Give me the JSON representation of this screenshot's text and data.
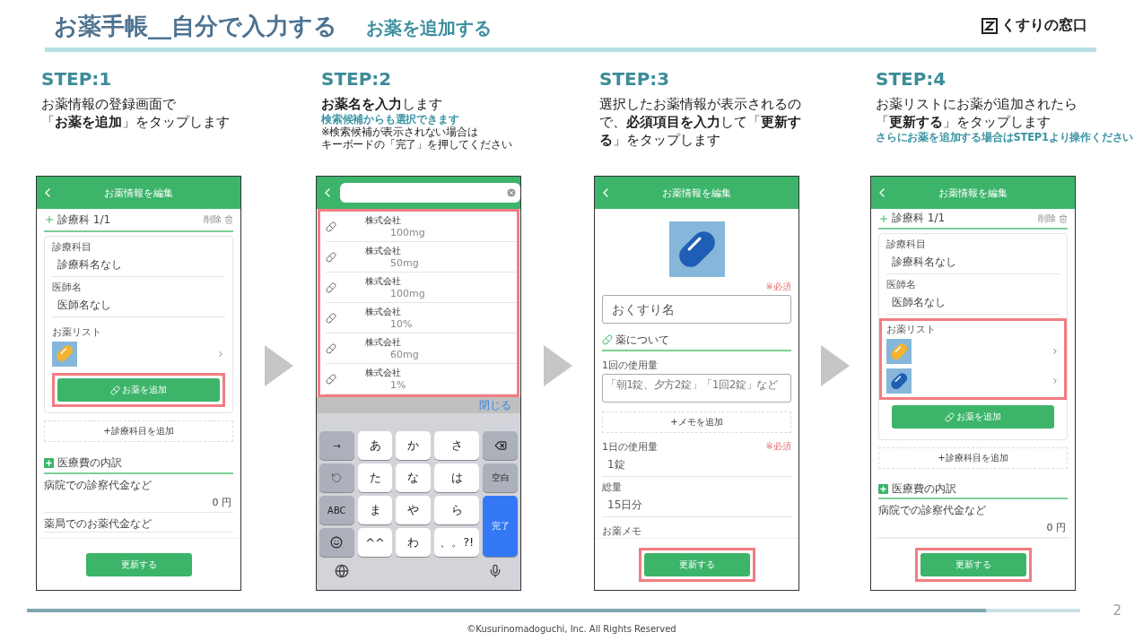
{
  "header": {
    "title": "お薬手帳__自分で入力する",
    "subtitle": "お薬を追加する",
    "logo": "くすりの窓口"
  },
  "steps": [
    {
      "label": "STEP:1",
      "lines": [
        "お薬情報の登録画面で",
        "「**お薬を追加**」をタップします"
      ],
      "phone": {
        "kind": "edit",
        "title": "お薬情報を編集",
        "section": "診療科 1/1",
        "delete": "削除",
        "fields": [
          {
            "label": "診療科目",
            "value": "診療科名なし"
          },
          {
            "label": "医師名",
            "value": "医師名なし"
          }
        ],
        "list_label": "お薬リスト",
        "list_highlighted": false,
        "medicines": [
          {
            "color": "#f2b431"
          }
        ],
        "add_button": {
          "label": "お薬を追加",
          "highlighted": true
        },
        "add_department": "+診療科目を追加",
        "cost_section": "医療費の内訳",
        "costs": [
          {
            "label": "病院での診察代金など",
            "value": "0 円"
          },
          {
            "label": "薬局でのお薬代金など"
          }
        ],
        "submit": {
          "label": "更新する",
          "highlighted": false
        }
      }
    },
    {
      "label": "STEP:2",
      "lines": [
        "**お薬名を入力**します"
      ],
      "notes": [
        {
          "kind": "accent",
          "text": "検索候補からも選択できます"
        },
        {
          "kind": "plain",
          "text": "※検索候補が表示されない場合は"
        },
        {
          "kind": "plain",
          "text": "キーボードの「完了」を押してください"
        }
      ],
      "phone": {
        "kind": "search",
        "results_highlighted": true,
        "results": [
          {
            "maker": "株式会社",
            "dose": "100mg"
          },
          {
            "maker": "株式会社",
            "dose": "50mg"
          },
          {
            "maker": "株式会社",
            "dose": "100mg"
          },
          {
            "maker": "株式会社",
            "dose": "10%"
          },
          {
            "maker": "株式会社",
            "dose": "60mg"
          },
          {
            "maker": "株式会社",
            "dose": "1%"
          }
        ],
        "close": "閉じる",
        "keys": [
          {
            "kind": "fn",
            "label": "→"
          },
          {
            "kind": "char",
            "label": "あ"
          },
          {
            "kind": "char",
            "label": "か"
          },
          {
            "kind": "char",
            "label": "さ"
          },
          {
            "kind": "backspace"
          },
          {
            "kind": "undo"
          },
          {
            "kind": "char",
            "label": "た"
          },
          {
            "kind": "char",
            "label": "な"
          },
          {
            "kind": "char",
            "label": "は"
          },
          {
            "kind": "fn",
            "label": "空白"
          },
          {
            "kind": "fn",
            "label": "ABC"
          },
          {
            "kind": "char",
            "label": "ま"
          },
          {
            "kind": "char",
            "label": "や"
          },
          {
            "kind": "char",
            "label": "ら"
          },
          {
            "kind": "done",
            "label": "完了"
          },
          {
            "kind": "emoji"
          },
          {
            "kind": "char",
            "label": "^^"
          },
          {
            "kind": "char",
            "label": "わ"
          },
          {
            "kind": "char",
            "label": "、。?!"
          }
        ]
      }
    },
    {
      "label": "STEP:3",
      "lines": [
        "選択したお薬情報が表示されるので、**必須項目を入力**して「**更新する**」をタップします"
      ],
      "phone": {
        "kind": "detail",
        "title": "お薬情報を編集",
        "required": "※必須",
        "name_placeholder": "おくすり名",
        "about": "薬について",
        "dose_label": "1回の使用量",
        "dose_placeholder": "「朝1錠、夕方2錠」「1回2錠」など",
        "add_memo": "+メモを追加",
        "fields": [
          {
            "label": "1日の使用量",
            "required": "※必須",
            "value": "1錠"
          },
          {
            "label": "総量",
            "value": "15日分"
          }
        ],
        "memo_label": "お薬メモ",
        "submit": {
          "label": "更新する",
          "highlighted": true
        }
      }
    },
    {
      "label": "STEP:4",
      "lines": [
        "お薬リストにお薬が追加されたら",
        "「**更新する**」をタップします"
      ],
      "notes": [
        {
          "kind": "accent",
          "text": "さらにお薬を追加する場合はSTEP1より操作ください"
        }
      ],
      "phone": {
        "kind": "edit",
        "title": "お薬情報を編集",
        "section": "診療科 1/1",
        "delete": "削除",
        "fields": [
          {
            "label": "診療科目",
            "value": "診療科名なし"
          },
          {
            "label": "医師名",
            "value": "医師名なし"
          }
        ],
        "list_label": "お薬リスト",
        "list_highlighted": true,
        "medicines": [
          {
            "color": "#f2b431"
          },
          {
            "color": "#1e5fb5"
          }
        ],
        "add_button": {
          "label": "お薬を追加",
          "highlighted": false
        },
        "add_department": "+診療科目を追加",
        "cost_section": "医療費の内訳",
        "costs": [
          {
            "label": "病院での診察代金など",
            "value": "0 円"
          }
        ],
        "submit": {
          "label": "更新する",
          "highlighted": true
        }
      }
    }
  ],
  "footer": {
    "progress": {
      "level": 0.91
    },
    "page": "2",
    "copyright": "©Kusurinomadoguchi, Inc. All Rights Reserved"
  }
}
